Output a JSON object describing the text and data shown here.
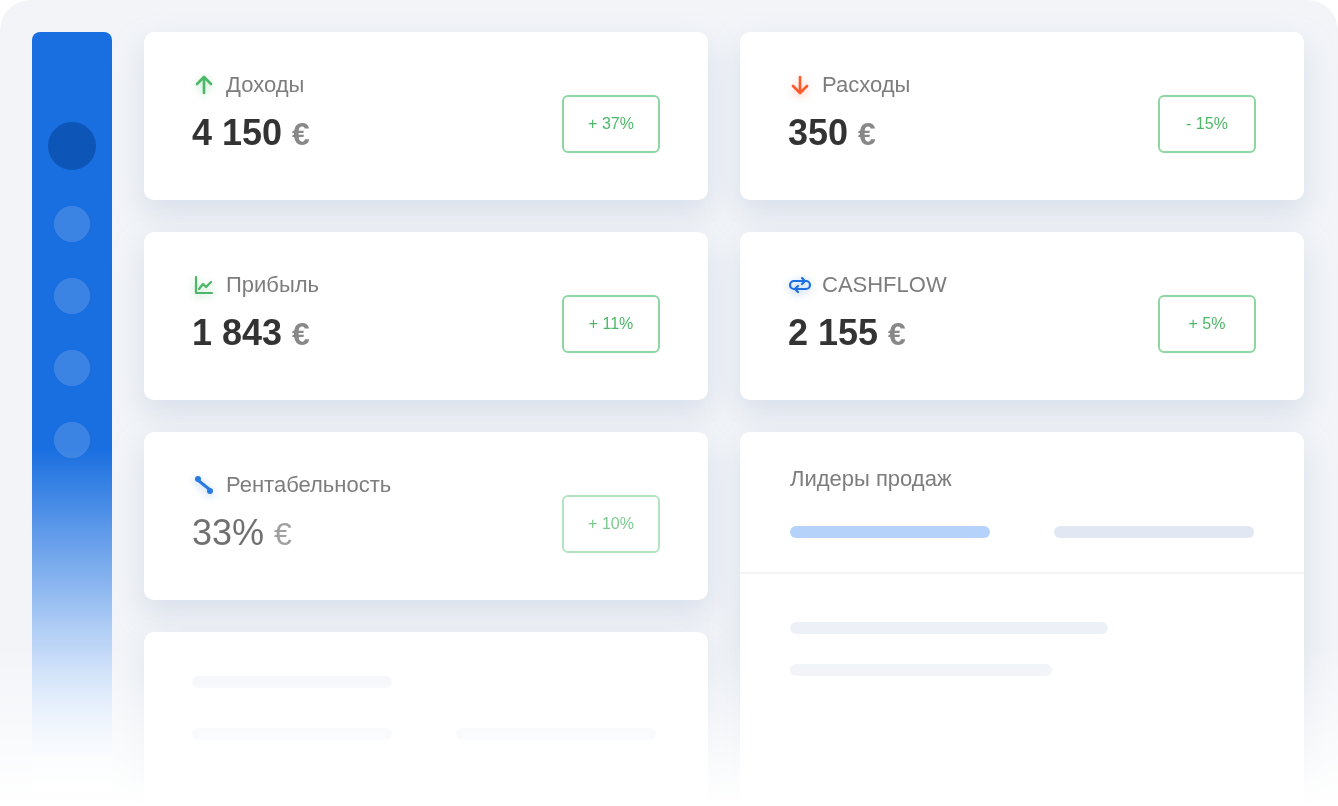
{
  "sidebar": {
    "items": [
      {
        "selected": true
      },
      {
        "selected": false
      },
      {
        "selected": false
      },
      {
        "selected": false
      },
      {
        "selected": false
      }
    ]
  },
  "metrics": [
    {
      "label": "Доходы",
      "value": "4 150",
      "currency": "€",
      "change": "+ 37%",
      "dimmed": false
    },
    {
      "label": "Расходы",
      "value": "350",
      "currency": "€",
      "change": "- 15%",
      "dimmed": false
    },
    {
      "label": "Прибыль",
      "value": "1 843",
      "currency": "€",
      "change": "+ 11%",
      "dimmed": false
    },
    {
      "label": "CASHFLOW",
      "value": "2 155",
      "currency": "€",
      "change": "+ 5%",
      "dimmed": false
    },
    {
      "label": "Рентабельность",
      "value": "33%",
      "currency": "€",
      "change": "+ 10%",
      "dimmed": true
    }
  ],
  "leaders": {
    "title": "Лидеры продаж",
    "tabs": [
      {
        "selected": true
      },
      {
        "selected": false
      }
    ]
  }
}
